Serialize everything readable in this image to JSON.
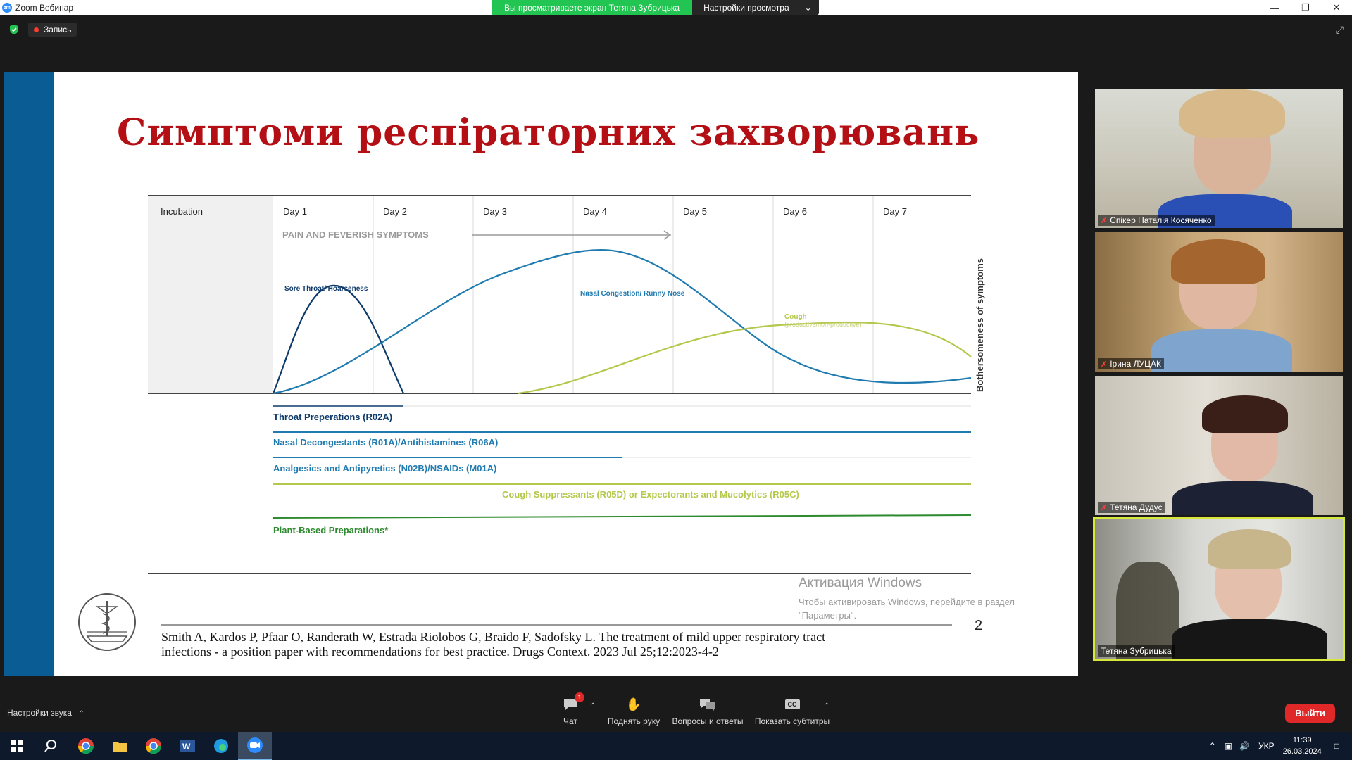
{
  "window": {
    "title": "Zoom Вебинар",
    "logo_text": "zm",
    "share_banner": "Вы просматриваете экран Тетяна Зубрицька",
    "view_settings": "Настройки просмотра"
  },
  "top": {
    "recording_label": "Запись"
  },
  "slide": {
    "title": "Симптоми респіраторних захворювань",
    "citation_line1": "Smith A, Kardos P, Pfaar O, Randerath W, Estrada Riolobos G, Braido F, Sadofsky L. The treatment of mild upper respiratory tract",
    "citation_line2": "infections - a position paper with recommendations for best practice. Drugs Context. 2023 Jul 25;12:2023-4-2",
    "page_number": "2",
    "watermark_title": "Активация Windows",
    "watermark_sub": "Чтобы активировать Windows, перейдите в раздел \"Параметры\"."
  },
  "chart_data": {
    "type": "line",
    "x_categories": [
      "Incubation",
      "Day 1",
      "Day 2",
      "Day 3",
      "Day 4",
      "Day 5",
      "Day 6",
      "Day 7"
    ],
    "phase_label": "PAIN AND FEVERISH SYMPTOMS",
    "ylabel": "Bothersomeness of symptoms",
    "series": [
      {
        "name": "Sore Throat/ Hoarseness",
        "color": "#0d3a6b"
      },
      {
        "name": "Nasal Congestion/ Runny Nose",
        "color": "#1f7bb0"
      },
      {
        "name": "Cough",
        "sublabel": "(productive/non-productive)",
        "color": "#b5c84b"
      }
    ],
    "treatments": [
      {
        "label": "Throat Preperations (R02A)",
        "color": "#0d3a6b"
      },
      {
        "label": "Nasal Decongestants (R01A)/Antihistamines (R06A)",
        "color": "#1f7bb0"
      },
      {
        "label": "Analgesics and Antipyretics (N02B)/NSAIDs (M01A)",
        "color": "#1f7bb0"
      },
      {
        "label": "Cough Suppressants (R05D) or Expectorants and Mucolytics (R05C)",
        "color": "#b5c84b"
      },
      {
        "label": "Plant-Based Preparations*",
        "color": "#2e8a2e"
      }
    ]
  },
  "participants": [
    {
      "name": "Спікер Наталія Косяченко",
      "muted": true,
      "active": false
    },
    {
      "name": "Ірина ЛУЦАК",
      "muted": true,
      "active": false
    },
    {
      "name": "Тетяна Дудус",
      "muted": true,
      "active": false
    },
    {
      "name": "Тетяна Зубрицька",
      "muted": false,
      "active": true
    }
  ],
  "toolbar": {
    "audio_settings": "Настройки звука",
    "chat_label": "Чат",
    "chat_badge": "1",
    "raise_hand_label": "Поднять руку",
    "qa_label": "Вопросы и ответы",
    "captions_label": "Показать субтитры",
    "captions_icon_text": "CC",
    "leave_label": "Выйти"
  },
  "taskbar": {
    "language": "УКР",
    "time": "11:39",
    "date": "26.03.2024"
  }
}
